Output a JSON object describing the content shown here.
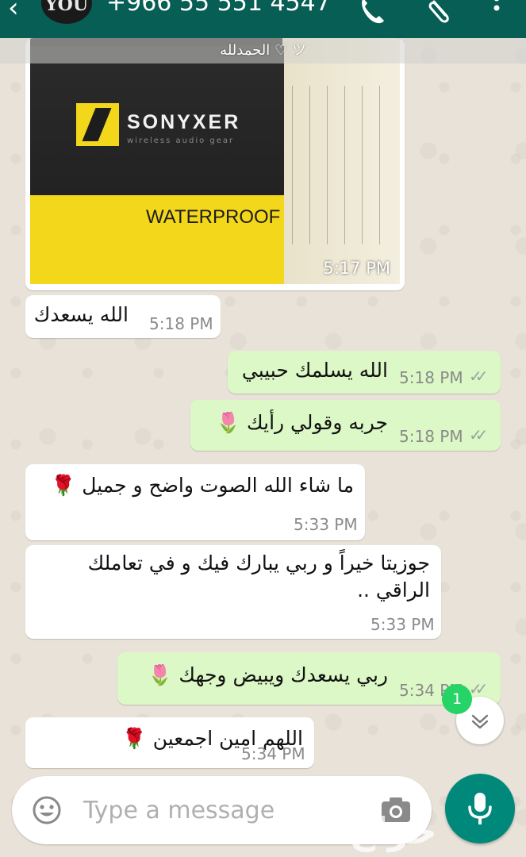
{
  "header": {
    "back_icon": "arrow-back-icon",
    "avatar_text": "YOU",
    "contact_title": "+966 55 551 4547",
    "icons": [
      "phone-icon",
      "paperclip-icon",
      "more-vert-icon"
    ],
    "status_text": "الحمدلله ♡ ツ"
  },
  "image_message": {
    "brand": "SONYXER",
    "tagline": "wireless audio gear",
    "badge": "WATERPROOF",
    "time": "5:17 PM"
  },
  "messages": [
    {
      "direction": "in",
      "text": "الله يسعدك",
      "time": "5:18 PM"
    },
    {
      "direction": "out",
      "text": "الله يسلمك حبيبي",
      "time": "5:18 PM",
      "status": "read"
    },
    {
      "direction": "out",
      "text": "جربه وقولي رأيك 🌷",
      "time": "5:18 PM",
      "status": "read"
    },
    {
      "direction": "in",
      "text": "ما شاء الله الصوت واضح و جميل 🌹",
      "time": "5:33 PM"
    },
    {
      "direction": "in",
      "text_line1": "جوزيتا خيراً و ربي يبارك فيك و في تعاملك",
      "text_line2": "الراقي ..",
      "time": "5:33 PM"
    },
    {
      "direction": "out",
      "text": "ربي يسعدك ويبيض وجهك 🌷",
      "time": "5:34 PM",
      "status": "read"
    },
    {
      "direction": "in",
      "text": "اللهم امين اجمعين 🌹",
      "time": "5:34 PM"
    }
  ],
  "scroll": {
    "unread_count": "1",
    "icon": "chevron-down-icon"
  },
  "input": {
    "placeholder": "Type a message",
    "emoji_icon": "emoji-icon",
    "camera_icon": "camera-icon",
    "mic_icon": "mic-icon"
  },
  "watermark": "حراج",
  "colors": {
    "header": "#075e54",
    "outgoing": "#dcf8c6",
    "incoming": "#ffffff",
    "accent": "#00897b",
    "badge": "#25d366"
  }
}
